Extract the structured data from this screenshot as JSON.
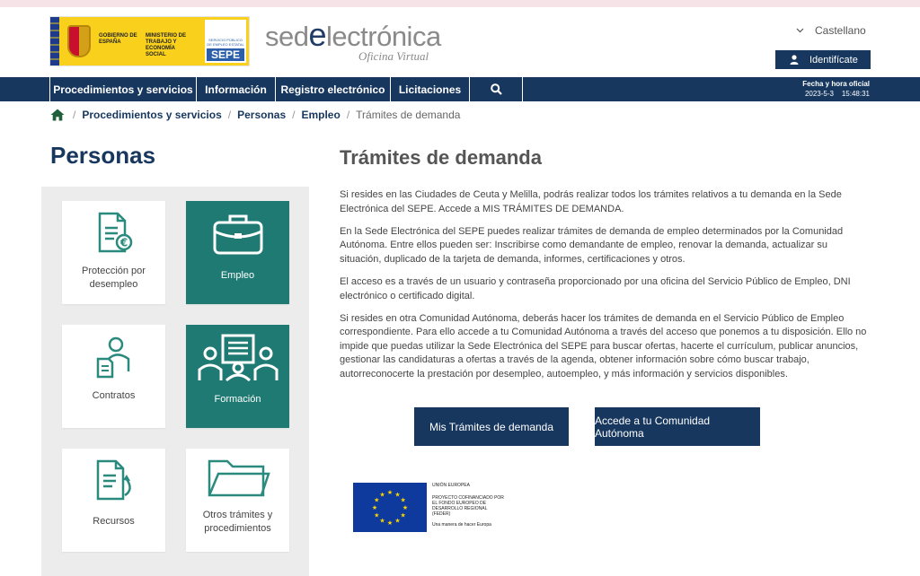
{
  "header": {
    "gov_text_1": "GOBIERNO DE ESPAÑA",
    "gov_text_2": "MINISTERIO DE TRABAJO Y ECONOMÍA SOCIAL",
    "sepe_small": "SERVICIO PÚBLICO DE EMPLEO ESTATAL",
    "sepe_mark": "SEPE",
    "sede_title_pre": "sed",
    "sede_title_e": "e",
    "sede_title_post": "lectrónica",
    "sede_subtitle": "Oficina Virtual",
    "language": "Castellano",
    "login_label": "Identifícate"
  },
  "nav": {
    "items": [
      {
        "label": "Procedimientos y servicios"
      },
      {
        "label": "Información"
      },
      {
        "label": "Registro electrónico"
      },
      {
        "label": "Licitaciones"
      }
    ],
    "datetime_label": "Fecha y hora oficial",
    "datetime_value": "2023-5-3    15:48:31"
  },
  "breadcrumb": {
    "items": [
      "Procedimientos y servicios",
      "Personas",
      "Empleo"
    ],
    "current": "Trámites de demanda"
  },
  "sidebar": {
    "title": "Personas",
    "cards": [
      {
        "label": "Protección por desempleo",
        "icon": "document-euro-icon",
        "active": false
      },
      {
        "label": "Empleo",
        "icon": "briefcase-icon",
        "active": true
      },
      {
        "label": "Contratos",
        "icon": "person-document-icon",
        "active": false
      },
      {
        "label": "Formación",
        "icon": "classroom-icon",
        "active": true
      },
      {
        "label": "Recursos",
        "icon": "document-arrow-icon",
        "active": false
      },
      {
        "label": "Otros trámites y procedimientos",
        "icon": "folder-icon",
        "active": false
      }
    ]
  },
  "main": {
    "title": "Trámites de demanda",
    "paragraphs": [
      "Si resides en las Ciudades de Ceuta y Melilla, podrás realizar todos los trámites relativos a tu demanda en la Sede Electrónica del SEPE. Accede a MIS TRÁMITES DE DEMANDA.",
      "En la Sede Electrónica del SEPE puedes realizar trámites de demanda de empleo determinados por la Comunidad Autónoma. Entre ellos pueden ser: Inscribirse como demandante de empleo, renovar la demanda, actualizar su situación, duplicado de la tarjeta de demanda, informes, certificaciones y otros.",
      "El acceso es a través de un usuario y contraseña proporcionado por una oficina del Servicio Público de Empleo, DNI electrónico o certificado digital.",
      "Si resides en otra Comunidad Autónoma, deberás hacer los trámites de demanda en el Servicio Público de Empleo correspondiente. Para ello accede a tu Comunidad Autónoma a través del acceso que ponemos a tu disposición. Ello no impide que puedas utilizar la Sede Electrónica del SEPE para buscar ofertas, hacerte el currículum, publicar anuncios, gestionar las candidaturas a ofertas a través de la agenda, obtener información sobre cómo buscar trabajo, autorreconocerte la prestación por desempleo, autoempleo, y más información y servicios disponibles."
    ],
    "buttons": {
      "mis_tramites": "Mis Trámites de demanda",
      "comunidad": "Accede a tu Comunidad Autónoma"
    },
    "eu": {
      "line1": "UNIÓN EUROPEA",
      "line2": "PROYECTO COFINANCIADO POR EL FONDO EUROPEO DE DESARROLLO REGIONAL (FEDER)",
      "line3": "Una manera de hacer Europa"
    }
  },
  "colors": {
    "navy": "#17375e",
    "teal": "#1f7a73",
    "panel": "#ececec"
  }
}
